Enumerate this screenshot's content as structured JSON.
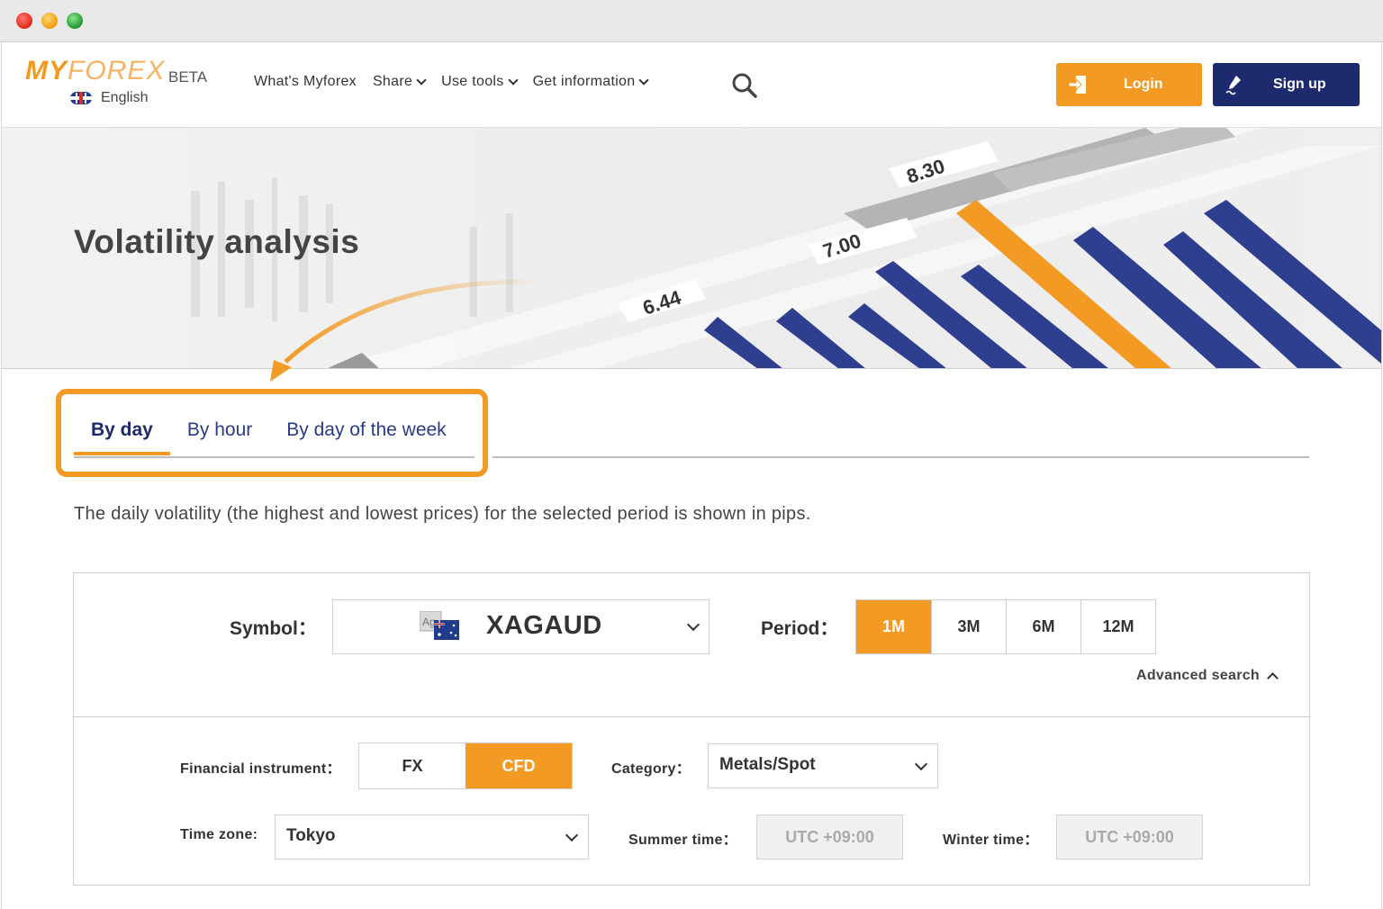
{
  "header": {
    "logo_bold": "MY",
    "logo_light": "FOREX",
    "logo_badge": "BETA",
    "language": "English",
    "nav": [
      {
        "label": "What's Myforex",
        "dropdown": false
      },
      {
        "label": "Share",
        "dropdown": true
      },
      {
        "label": "Use tools",
        "dropdown": true
      },
      {
        "label": "Get information",
        "dropdown": true
      }
    ],
    "login_label": "Login",
    "signup_label": "Sign up"
  },
  "hero": {
    "title": "Volatility analysis",
    "badges": [
      "6.44",
      "7.00",
      "8.30"
    ]
  },
  "tabs": [
    {
      "label": "By day",
      "active": true
    },
    {
      "label": "By hour",
      "active": false
    },
    {
      "label": "By day of the week",
      "active": false
    }
  ],
  "description": "The daily volatility (the highest and lowest prices) for the selected period is shown in pips.",
  "search": {
    "symbol_label": "Symbol：",
    "symbol_value": "XAGAUD",
    "symbol_flag_text": "Ag",
    "period_label": "Period：",
    "periods": [
      {
        "label": "1M",
        "active": true
      },
      {
        "label": "3M",
        "active": false
      },
      {
        "label": "6M",
        "active": false
      },
      {
        "label": "12M",
        "active": false
      }
    ],
    "advanced_label": "Advanced search"
  },
  "advanced": {
    "instrument_label": "Financial instrument：",
    "instruments": [
      {
        "label": "FX",
        "active": false
      },
      {
        "label": "CFD",
        "active": true
      }
    ],
    "category_label": "Category：",
    "category_value": "Metals/Spot",
    "timezone_label": "Time zone:",
    "timezone_value": "Tokyo",
    "summer_label": "Summer time：",
    "summer_value": "UTC +09:00",
    "winter_label": "Winter time：",
    "winter_value": "UTC +09:00"
  },
  "colors": {
    "accent": "#f39a24",
    "navy": "#1e2a6e",
    "bar_blue": "#2f3f8f"
  }
}
